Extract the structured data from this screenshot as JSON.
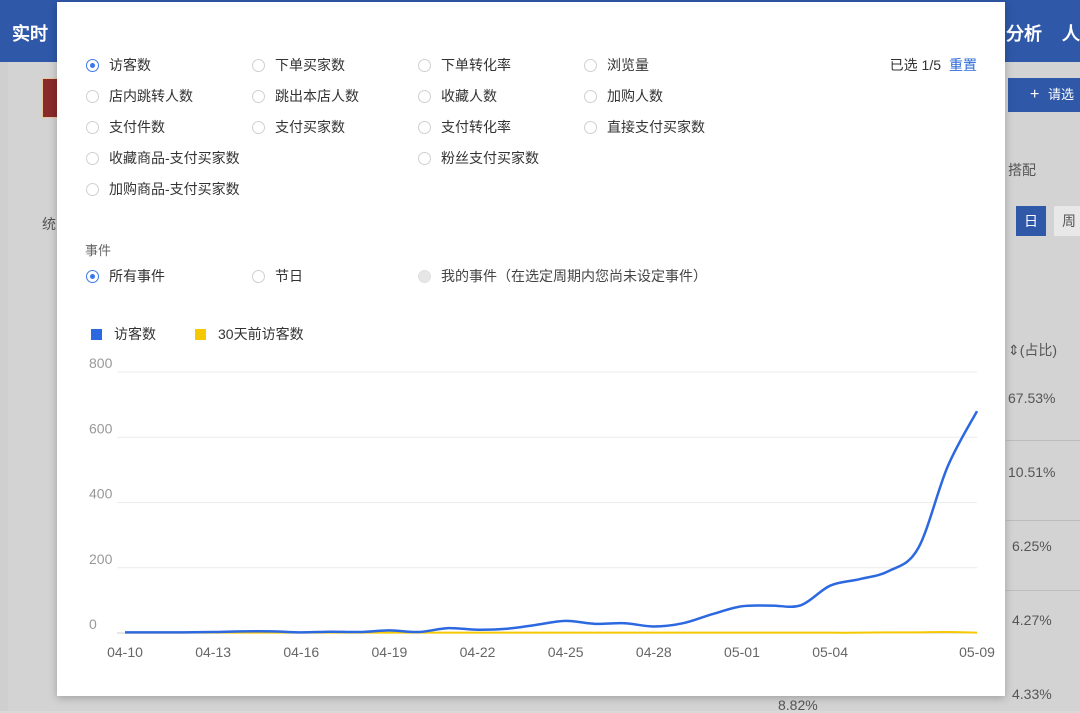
{
  "background": {
    "nav_left": "实时",
    "nav_right": "分析",
    "nav_far_right": "人",
    "add_button_label": "请选",
    "side_label_1": "搭配",
    "side_label_2": "统",
    "day_button": "日",
    "week_button": "周",
    "ratio_header": "(占比)",
    "ratios": [
      "67.53%",
      "10.51%",
      "6.25%",
      "4.27%",
      "4.33%"
    ],
    "bottom_value": "8.82%"
  },
  "modal": {
    "metrics": [
      {
        "label": "访客数",
        "checked": true
      },
      {
        "label": "下单买家数",
        "checked": false
      },
      {
        "label": "下单转化率",
        "checked": false
      },
      {
        "label": "浏览量",
        "checked": false
      },
      {
        "label": "店内跳转人数",
        "checked": false
      },
      {
        "label": "跳出本店人数",
        "checked": false
      },
      {
        "label": "收藏人数",
        "checked": false
      },
      {
        "label": "加购人数",
        "checked": false
      },
      {
        "label": "支付件数",
        "checked": false
      },
      {
        "label": "支付买家数",
        "checked": false
      },
      {
        "label": "支付转化率",
        "checked": false
      },
      {
        "label": "直接支付买家数",
        "checked": false
      },
      {
        "label": "收藏商品-支付买家数",
        "checked": false
      },
      {
        "label": "粉丝支付买家数",
        "checked": false
      },
      {
        "label": "加购商品-支付买家数",
        "checked": false
      }
    ],
    "selected_count": "已选 1/5",
    "reset_label": "重置",
    "events_label": "事件",
    "events": [
      {
        "label": "所有事件",
        "checked": true,
        "disabled": false
      },
      {
        "label": "节日",
        "checked": false,
        "disabled": false
      },
      {
        "label": "我的事件（在选定周期内您尚未设定事件）",
        "checked": false,
        "disabled": true
      }
    ]
  },
  "chart_data": {
    "type": "line",
    "x": [
      "04-10",
      "04-11",
      "04-12",
      "04-13",
      "04-14",
      "04-15",
      "04-16",
      "04-17",
      "04-18",
      "04-19",
      "04-20",
      "04-21",
      "04-22",
      "04-23",
      "04-24",
      "04-25",
      "04-26",
      "04-27",
      "04-28",
      "04-29",
      "04-30",
      "05-01",
      "05-02",
      "05-03",
      "05-04",
      "05-05",
      "05-06",
      "05-07",
      "05-08",
      "05-09"
    ],
    "x_ticks": [
      "04-10",
      "04-13",
      "04-16",
      "04-19",
      "04-22",
      "04-25",
      "04-28",
      "05-01",
      "05-04",
      "05-09"
    ],
    "series": [
      {
        "name": "访客数",
        "color": "#2c68e0",
        "values": [
          2,
          2,
          2,
          3,
          5,
          5,
          2,
          4,
          3,
          8,
          3,
          15,
          10,
          13,
          25,
          37,
          28,
          30,
          20,
          30,
          58,
          82,
          84,
          85,
          145,
          165,
          190,
          260,
          510,
          680
        ]
      },
      {
        "name": "30天前访客数",
        "color": "#f5c800",
        "values": [
          1,
          1,
          1,
          1,
          1,
          1,
          1,
          1,
          1,
          1,
          1,
          1,
          1,
          1,
          1,
          1,
          1,
          1,
          1,
          1,
          1,
          1,
          1,
          1,
          1,
          1,
          2,
          2,
          3,
          1
        ]
      }
    ],
    "ylim": [
      0,
      800
    ],
    "y_ticks": [
      0,
      200,
      400,
      600,
      800
    ],
    "grid": true,
    "legend": "top-left"
  }
}
